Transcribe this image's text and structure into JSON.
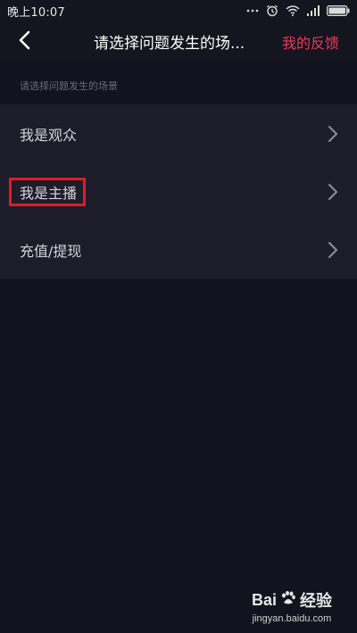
{
  "status_bar": {
    "time": "晚上10:07"
  },
  "header": {
    "title": "请选择问题发生的场...",
    "feedback_label": "我的反馈"
  },
  "section": {
    "label": "请选择问题发生的场景"
  },
  "list": {
    "items": [
      {
        "label": "我是观众"
      },
      {
        "label": "我是主播"
      },
      {
        "label": "充值/提现"
      }
    ]
  },
  "watermark": {
    "brand_left": "Bai",
    "brand_right": "经验",
    "url": "jingyan.baidu.com"
  },
  "colors": {
    "accent": "#f0395a",
    "highlight": "#e21b24",
    "background": "#13131f",
    "list_background": "#1d1d2a"
  },
  "icons": [
    "back-arrow-icon",
    "chevron-right-icon",
    "alarm-icon",
    "wifi-icon",
    "signal-icon",
    "battery-icon"
  ]
}
